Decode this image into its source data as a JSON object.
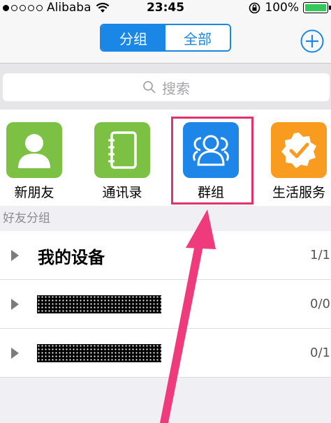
{
  "status_bar": {
    "carrier": "Alibaba",
    "time": "23:45",
    "battery_text": "100%"
  },
  "nav": {
    "segments": [
      "分组",
      "全部"
    ],
    "active_segment": "分组",
    "add_icon": "plus-circle-icon"
  },
  "search": {
    "placeholder": "搜索"
  },
  "shortcuts": [
    {
      "label": "新朋友",
      "icon": "person-icon",
      "color": "#7cc144"
    },
    {
      "label": "通讯录",
      "icon": "address-book-icon",
      "color": "#7cc144"
    },
    {
      "label": "群组",
      "icon": "group-icon",
      "color": "#1e86e8"
    },
    {
      "label": "生活服务",
      "icon": "badge-check-icon",
      "color": "#f89b1e"
    }
  ],
  "friend_groups": {
    "header": "好友分组",
    "groups": [
      {
        "name": "我的设备",
        "count": "1/1"
      },
      {
        "name": "",
        "count": "0/0"
      },
      {
        "name": "",
        "count": "0/1"
      }
    ]
  },
  "colors": {
    "accent_blue": "#1a87e6",
    "highlight_pink": "#e0336b"
  }
}
